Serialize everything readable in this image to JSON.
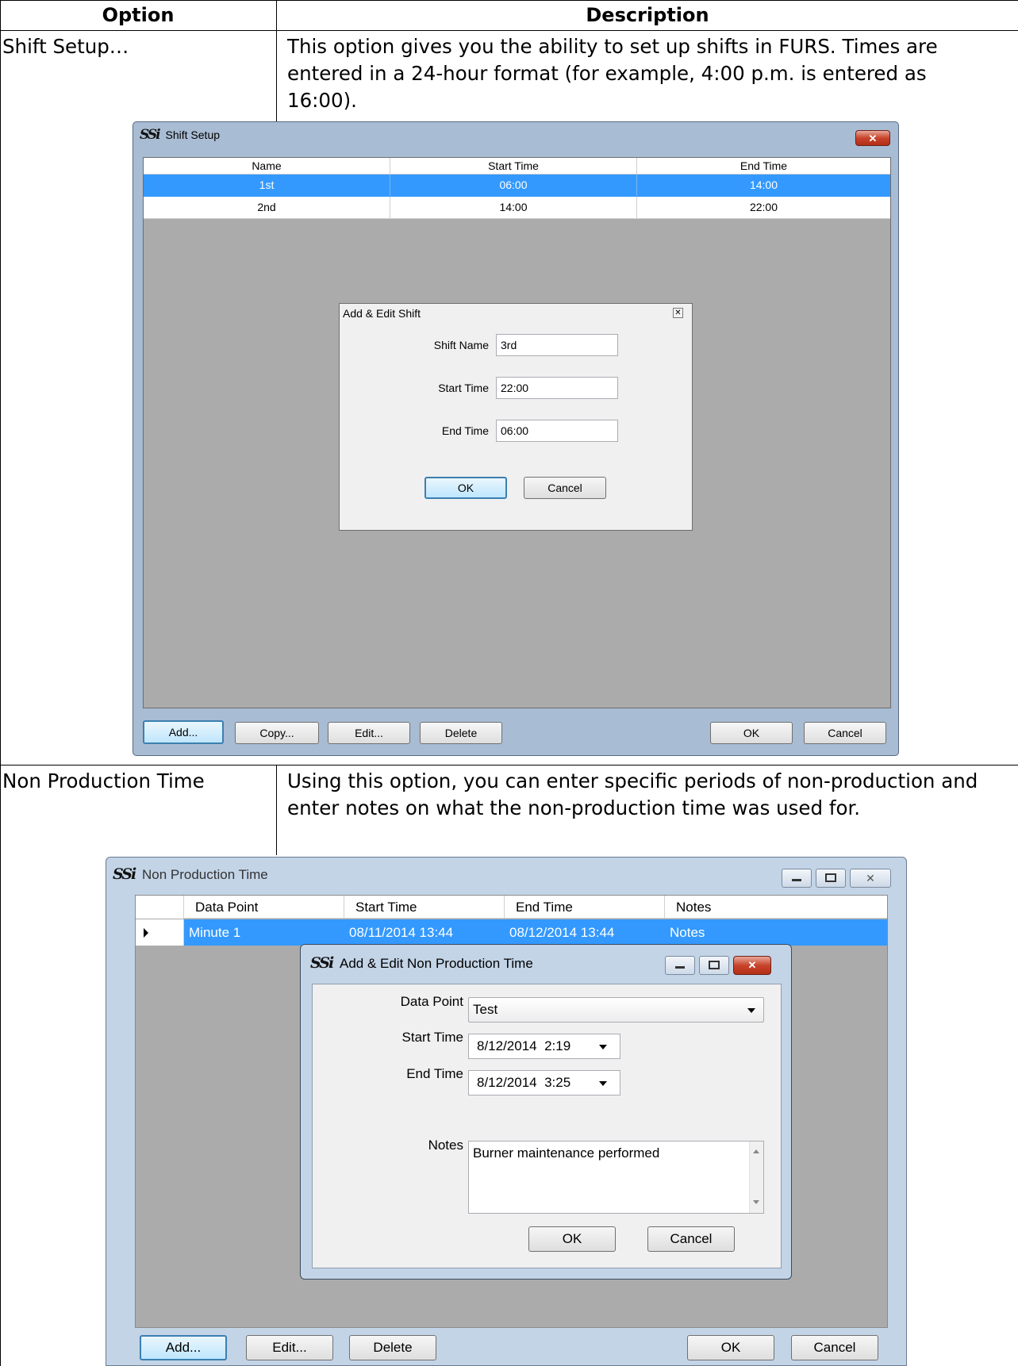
{
  "table": {
    "header_option": "Option",
    "header_description": "Description"
  },
  "rows": [
    {
      "option": "Shift Setup…",
      "description": "This option gives you the ability to set up shifts in FURS. Times are entered in a 24-hour format (for example, 4:00 p.m. is entered as 16:00)."
    },
    {
      "option": "Non Production Time",
      "description": "Using this option, you can enter specific periods of non-production and enter notes on what the non-production time was used for."
    }
  ],
  "shift_window": {
    "logo": "SSi",
    "title": "Shift Setup",
    "columns": [
      "Name",
      "Start Time",
      "End Time"
    ],
    "rows": [
      {
        "name": "1st",
        "start": "06:00",
        "end": "14:00",
        "selected": true
      },
      {
        "name": "2nd",
        "start": "14:00",
        "end": "22:00",
        "selected": false
      }
    ],
    "buttons": {
      "add": "Add...",
      "copy": "Copy...",
      "edit": "Edit...",
      "delete": "Delete",
      "ok": "OK",
      "cancel": "Cancel"
    },
    "close_glyph": "✕",
    "dialog": {
      "title": "Add & Edit Shift",
      "shift_name_label": "Shift Name",
      "shift_name_value": "3rd",
      "start_time_label": "Start Time",
      "start_time_value": "22:00",
      "end_time_label": "End Time",
      "end_time_value": "06:00",
      "ok": "OK",
      "cancel": "Cancel"
    }
  },
  "npt_window": {
    "logo": "SSi",
    "title": "Non Production Time",
    "columns": [
      "Data Point",
      "Start Time",
      "End Time",
      "Notes"
    ],
    "rows": [
      {
        "data_point": "Minute 1",
        "start": "08/11/2014 13:44",
        "end": "08/12/2014 13:44",
        "notes": "Notes",
        "selected": true
      }
    ],
    "buttons": {
      "add": "Add...",
      "edit": "Edit...",
      "delete": "Delete",
      "ok": "OK",
      "cancel": "Cancel"
    },
    "dialog": {
      "title": "Add & Edit Non Production Time",
      "data_point_label": "Data Point",
      "data_point_value": "Test",
      "start_time_label": "Start Time",
      "start_time_value": "8/12/2014  2:19",
      "end_time_label": "End Time",
      "end_time_value": "8/12/2014  3:25",
      "notes_label": "Notes",
      "notes_value": "Burner maintenance performed",
      "ok": "OK",
      "cancel": "Cancel"
    }
  },
  "colors": {
    "selection": "#3399ff",
    "grid_background": "#ababab",
    "close_button": "#c8442b"
  }
}
